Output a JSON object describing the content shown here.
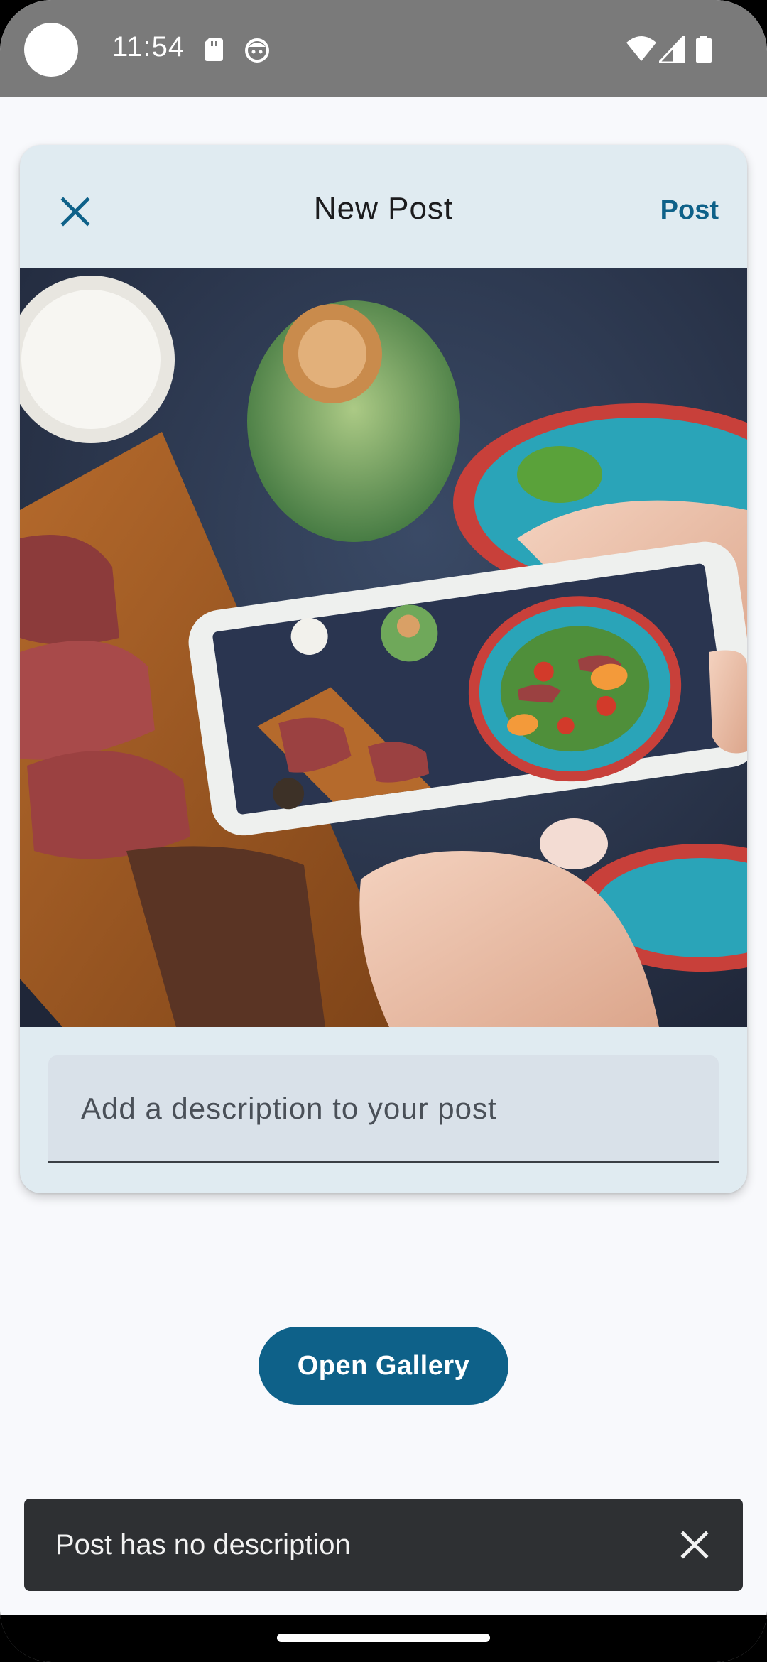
{
  "status_bar": {
    "time": "11:54",
    "icons": [
      "sd-card-icon",
      "face-icon",
      "wifi-icon",
      "signal-icon",
      "battery-icon"
    ]
  },
  "header": {
    "title": "New Post",
    "close_icon": "close-icon",
    "post_label": "Post"
  },
  "photo": {
    "description": "hands photographing a plate of salad and sliced steak with a smartphone"
  },
  "description_field": {
    "placeholder": "Add a description to your post",
    "value": ""
  },
  "actions": {
    "open_gallery_label": "Open Gallery"
  },
  "snackbar": {
    "message": "Post has no description",
    "close_icon": "close-icon"
  },
  "colors": {
    "accent": "#0e6189",
    "card_background": "#e0ebf1",
    "status_bar": "#7a7a7a",
    "snackbar": "#2e3033",
    "page_background": "#f8f9fc"
  }
}
